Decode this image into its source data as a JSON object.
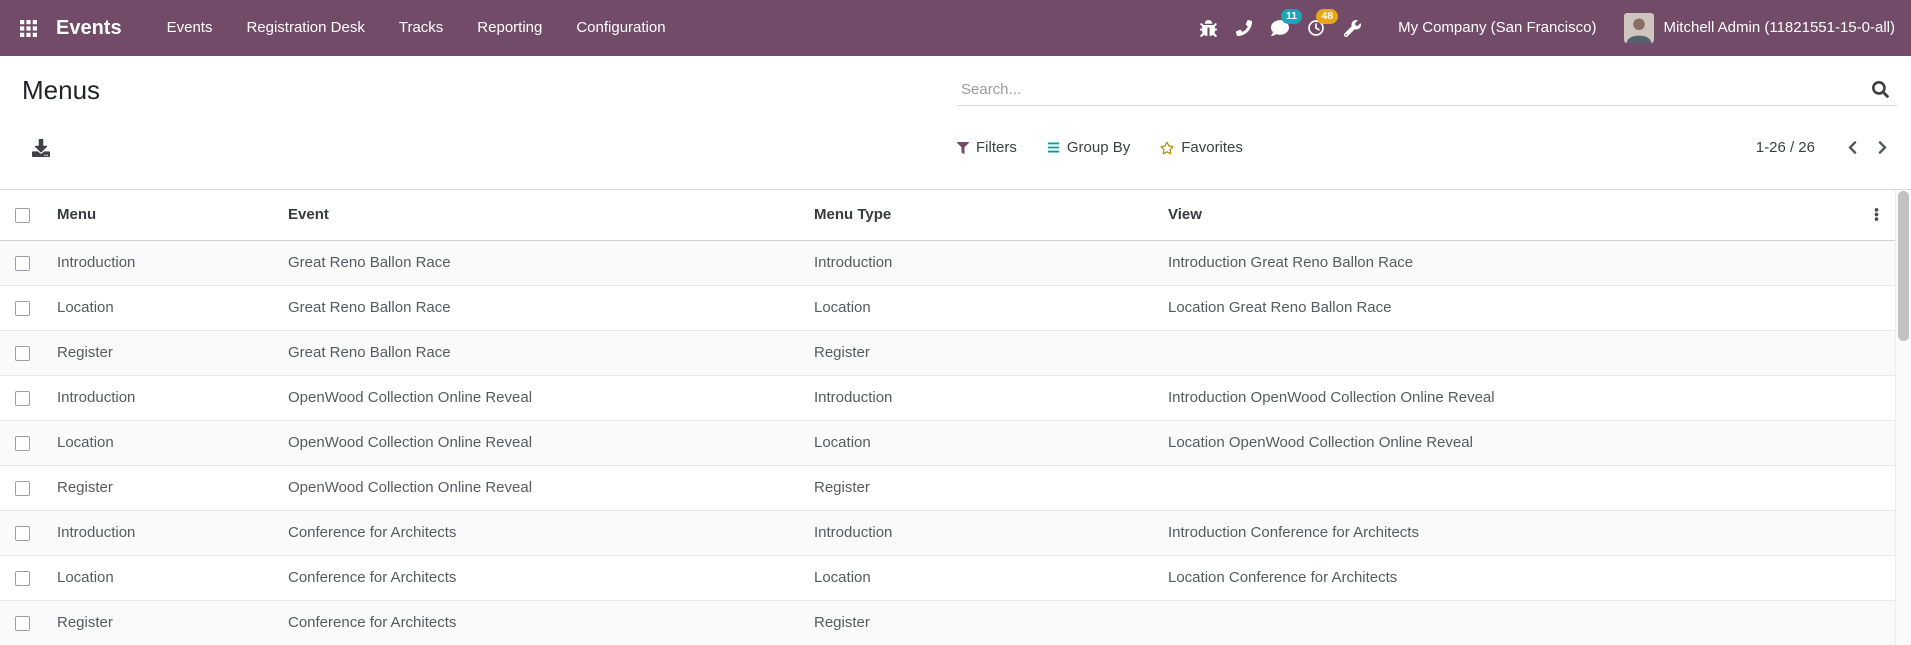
{
  "topbar": {
    "app_name": "Events",
    "menu_items": [
      "Events",
      "Registration Desk",
      "Tracks",
      "Reporting",
      "Configuration"
    ],
    "badges": {
      "messages": "11",
      "activities": "48"
    },
    "company": "My Company (San Francisco)",
    "user": "Mitchell Admin (11821551-15-0-all)"
  },
  "control_panel": {
    "title": "Menus",
    "search_placeholder": "Search...",
    "filters_label": "Filters",
    "group_by_label": "Group By",
    "favorites_label": "Favorites",
    "pager_range": "1-26 / 26"
  },
  "table": {
    "columns": [
      "Menu",
      "Event",
      "Menu Type",
      "View"
    ],
    "rows": [
      {
        "menu": "Introduction",
        "event": "Great Reno Ballon Race",
        "menu_type": "Introduction",
        "view": "Introduction Great Reno Ballon Race"
      },
      {
        "menu": "Location",
        "event": "Great Reno Ballon Race",
        "menu_type": "Location",
        "view": "Location Great Reno Ballon Race"
      },
      {
        "menu": "Register",
        "event": "Great Reno Ballon Race",
        "menu_type": "Register",
        "view": ""
      },
      {
        "menu": "Introduction",
        "event": "OpenWood Collection Online Reveal",
        "menu_type": "Introduction",
        "view": "Introduction OpenWood Collection Online Reveal"
      },
      {
        "menu": "Location",
        "event": "OpenWood Collection Online Reveal",
        "menu_type": "Location",
        "view": "Location OpenWood Collection Online Reveal"
      },
      {
        "menu": "Register",
        "event": "OpenWood Collection Online Reveal",
        "menu_type": "Register",
        "view": ""
      },
      {
        "menu": "Introduction",
        "event": "Conference for Architects",
        "menu_type": "Introduction",
        "view": "Introduction Conference for Architects"
      },
      {
        "menu": "Location",
        "event": "Conference for Architects",
        "menu_type": "Location",
        "view": "Location Conference for Architects"
      },
      {
        "menu": "Register",
        "event": "Conference for Architects",
        "menu_type": "Register",
        "view": ""
      }
    ]
  },
  "icons": {
    "apps_menu": "grid-3x3",
    "debug": "bug",
    "voip": "phone",
    "messages": "comment-bubble",
    "activities": "clock",
    "tools": "wrench",
    "search": "magnifier",
    "export": "download-tray",
    "filters": "funnel",
    "group_by": "bars",
    "favorites": "star-outline",
    "pager_previous": "chevron-left",
    "pager_next": "chevron-right",
    "optional_columns": "vertical-kebab-dots"
  },
  "colors": {
    "topbar_bg": "#714B67",
    "badge_messages": "#1ca5b8",
    "badge_activities": "#e9a61a",
    "filter_icon": "#714B67",
    "groupby_icon": "#00A09D",
    "favorites_icon": "#a58b00"
  }
}
